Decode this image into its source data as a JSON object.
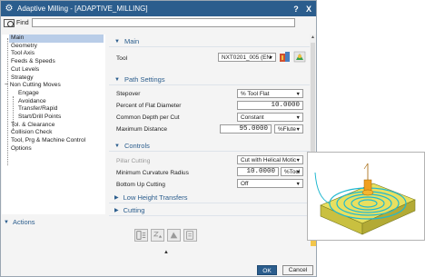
{
  "window": {
    "title": "Adaptive Milling - [ADAPTIVE_MILLING]",
    "help_label": "?",
    "close_label": "X"
  },
  "find": {
    "label": "Find",
    "value": ""
  },
  "nav": {
    "items": [
      {
        "label": "Main",
        "selected": true
      },
      {
        "label": "Geometry"
      },
      {
        "label": "Tool Axis"
      },
      {
        "label": "Feeds & Speeds"
      },
      {
        "label": "Cut Levels"
      },
      {
        "label": "Strategy"
      },
      {
        "label": "Non Cutting Moves",
        "expanded_marker": "−"
      },
      {
        "label": "Engage"
      },
      {
        "label": "Avoidance"
      },
      {
        "label": "Transfer/Rapid"
      },
      {
        "label": "Start/Drill Points"
      },
      {
        "label": "Tol. & Clearance"
      },
      {
        "label": "Collision Check"
      },
      {
        "label": "Tool, Prg & Machine Control"
      },
      {
        "label": "Options"
      }
    ]
  },
  "sections": {
    "main": {
      "title": "Main",
      "tool_label": "Tool",
      "tool_value": "NXT0201_005 (EN"
    },
    "path_settings": {
      "title": "Path Settings",
      "stepover_label": "Stepover",
      "stepover_value": "% Tool Flat",
      "percent_label": "Percent of Flat Diameter",
      "percent_value": "10.0000",
      "common_depth_label": "Common Depth per Cut",
      "common_depth_value": "Constant",
      "max_distance_label": "Maximum Distance",
      "max_distance_value": "95.0000",
      "max_distance_unit": "%Flute"
    },
    "controls": {
      "title": "Controls",
      "pillar_label": "Pillar Cutting",
      "pillar_value": "Cut with Helical Motic",
      "min_curvature_label": "Minimum Curvature Radius",
      "min_curvature_value": "10.0000",
      "min_curvature_unit": "%Tool",
      "bottom_up_label": "Bottom Up Cutting",
      "bottom_up_value": "Off"
    },
    "low_height": {
      "title": "Low Height Transfers"
    },
    "cutting": {
      "title": "Cutting"
    }
  },
  "actions": {
    "title": "Actions",
    "ok_label": "OK",
    "cancel_label": "Cancel"
  },
  "colors": {
    "title_bar": "#2b5d8d",
    "accent": "#2b5d8d",
    "selected_nav": "#b9cde8",
    "preview_block": "#e8e060",
    "preview_toolpath": "#20b8d0"
  }
}
